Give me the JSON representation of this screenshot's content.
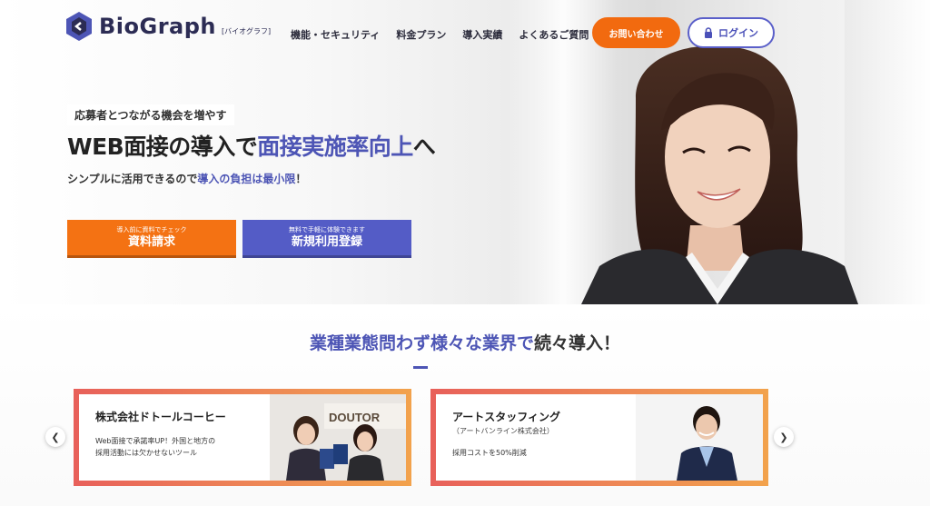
{
  "header": {
    "logo_text": "BioGraph",
    "logo_sub": "[バイオグラフ]",
    "nav": [
      "機能・セキュリティ",
      "料金プラン",
      "導入実績",
      "よくあるご質問"
    ],
    "contact_label": "お問い合わせ",
    "login_label": "ログイン"
  },
  "hero": {
    "tagline": "応募者とつながる機会を増やす",
    "headline_part1": "WEB面接の導入で",
    "headline_hl": "面接実施率向上",
    "headline_part2": "へ",
    "sub_part1": "シンプルに活用できるので",
    "sub_hl": "導入の負担は最小限",
    "sub_part2": "！",
    "cta_docs_small": "導入前に資料でチェック",
    "cta_docs_main": "資料請求",
    "cta_signup_small": "無料で手軽に体験できます",
    "cta_signup_main": "新規利用登録"
  },
  "cases_section": {
    "title_hl": "業種業態問わず様々な業界で",
    "title_rest": "続々導入！",
    "cards": [
      {
        "company": "株式会社ドトールコーヒー",
        "subtitle": "",
        "desc_line1": "Web面接で承諾率UP！外国と地方の",
        "desc_line2": "採用活動には欠かせないツール",
        "photo_sign": "DOUTOR"
      },
      {
        "company": "アートスタッフィング",
        "subtitle": "（アートバンライン株式会社）",
        "desc_line1": "採用コストを50%削減",
        "desc_line2": ""
      }
    ]
  },
  "colors": {
    "brand_blue": "#4d55b5",
    "brand_orange": "#f26a0f",
    "navy": "#2c2c54"
  },
  "icons": {
    "logo": "hexagon-logo-icon",
    "login": "lock-icon",
    "prev": "chevron-left-icon",
    "next": "chevron-right-icon"
  }
}
